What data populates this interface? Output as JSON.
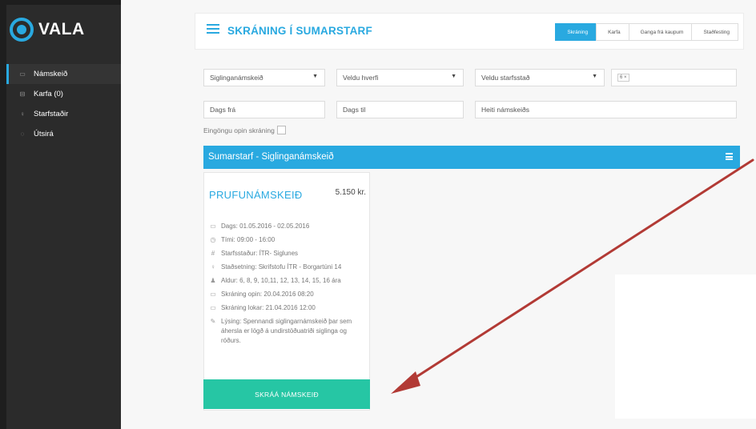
{
  "app": {
    "logo_text": "VALA"
  },
  "sidebar": {
    "items": [
      {
        "label": "Námskeið",
        "icon": "calendar-icon"
      },
      {
        "label": "Karfa (0)",
        "icon": "cart-icon"
      },
      {
        "label": "Starfstaðir",
        "icon": "map-pin-icon"
      },
      {
        "label": "Útsirá",
        "icon": "power-icon"
      }
    ]
  },
  "header": {
    "title": "SKRÁNING Í SUMARSTARF",
    "steps": [
      "Skráning",
      "Karfa",
      "Ganga frá kaupum",
      "Staðfesting"
    ]
  },
  "filters": {
    "course_type": "Siglinganámskeið",
    "district_placeholder": "Veldu hverfi",
    "location_placeholder": "Veldu starfsstað",
    "age_badge": "6 ×",
    "date_from_placeholder": "Dags frá",
    "date_to_placeholder": "Dags til",
    "course_name_placeholder": "Heiti námskeiðs",
    "open_only_label": "Eingöngu opin skráning"
  },
  "section": {
    "title": "Sumarstarf - Siglinganámskeið"
  },
  "course": {
    "title": "PRUFUNÁMSKEIÐ",
    "price": "5.150 kr.",
    "details": [
      {
        "icon": "calendar-icon",
        "text": "Dags: 01.05.201‌6 - 02.05.2016"
      },
      {
        "icon": "clock-icon",
        "text": "Tími: 09:00 - 16:00"
      },
      {
        "icon": "building-icon",
        "text": "Starfsstaður: ÍTR- Siglunes"
      },
      {
        "icon": "map-pin-icon",
        "text": "Staðsetning: Skrifstofu ÍTR - Borgartúni 14"
      },
      {
        "icon": "user-icon",
        "text": "Aldur: 6, 8, 9, 10,11, 12, 13, 14, 15, 16 ára"
      },
      {
        "icon": "calendar-icon",
        "text": "Skráning opin: 20.04.2016 08:20"
      },
      {
        "icon": "calendar-icon",
        "text": "Skráning lokar: 21.04.2016 12:00"
      },
      {
        "icon": "pencil-icon",
        "text": "Lýsing: Spennandi siglingarnámskeið þar sem áhersla er lögð á undirstöðuatriði siglinga og róðurs."
      }
    ],
    "enroll_label": "SKRÁÁ NÁMSKEIÐ"
  },
  "colors": {
    "accent": "#29a9e0",
    "button": "#26c6a4",
    "arrow": "#b23a35"
  }
}
